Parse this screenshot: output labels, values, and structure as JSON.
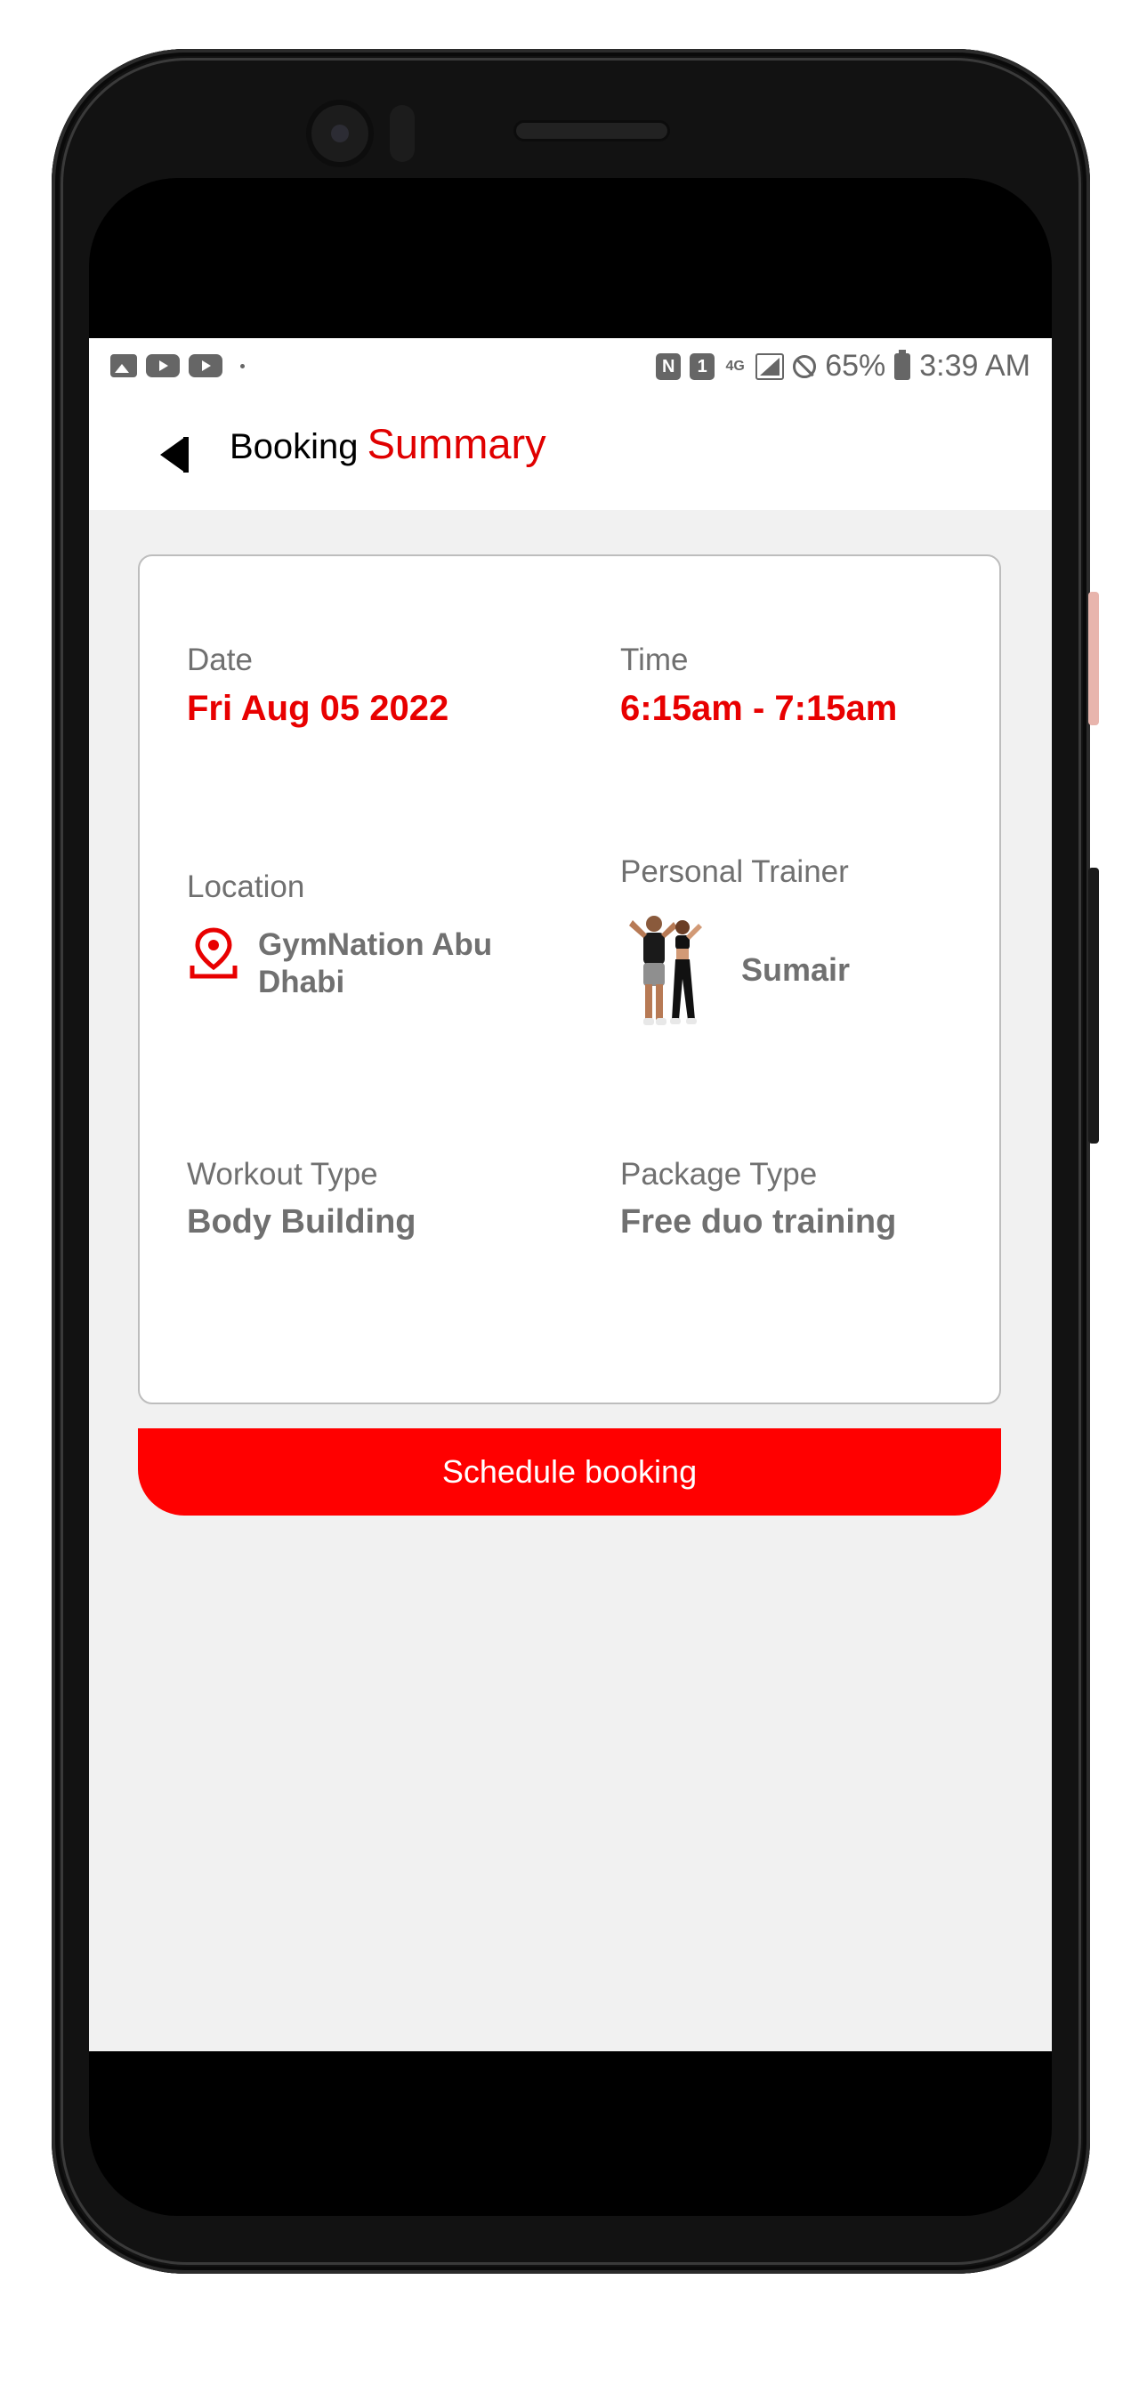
{
  "status_bar": {
    "left_icons": [
      "image-icon",
      "youtube-icon",
      "youtube-icon"
    ],
    "nfc": "N",
    "sim": "1",
    "network": "4G",
    "battery": "65%",
    "time": "3:39 AM"
  },
  "header": {
    "title_plain": "Booking",
    "title_accent": "Summary"
  },
  "booking": {
    "date_label": "Date",
    "date_value": "Fri Aug 05 2022",
    "time_label": "Time",
    "time_value": "6:15am - 7:15am",
    "location_label": "Location",
    "location_value": "GymNation Abu Dhabi",
    "trainer_label": "Personal Trainer",
    "trainer_name": "Sumair",
    "workout_label": "Workout Type",
    "workout_value": "Body Building",
    "package_label": "Package Type",
    "package_value": "Free duo training"
  },
  "actions": {
    "schedule_label": "Schedule booking"
  },
  "colors": {
    "accent": "#e80000",
    "button": "#ff0000",
    "muted_text": "#707070",
    "background": "#f1f1f1"
  }
}
